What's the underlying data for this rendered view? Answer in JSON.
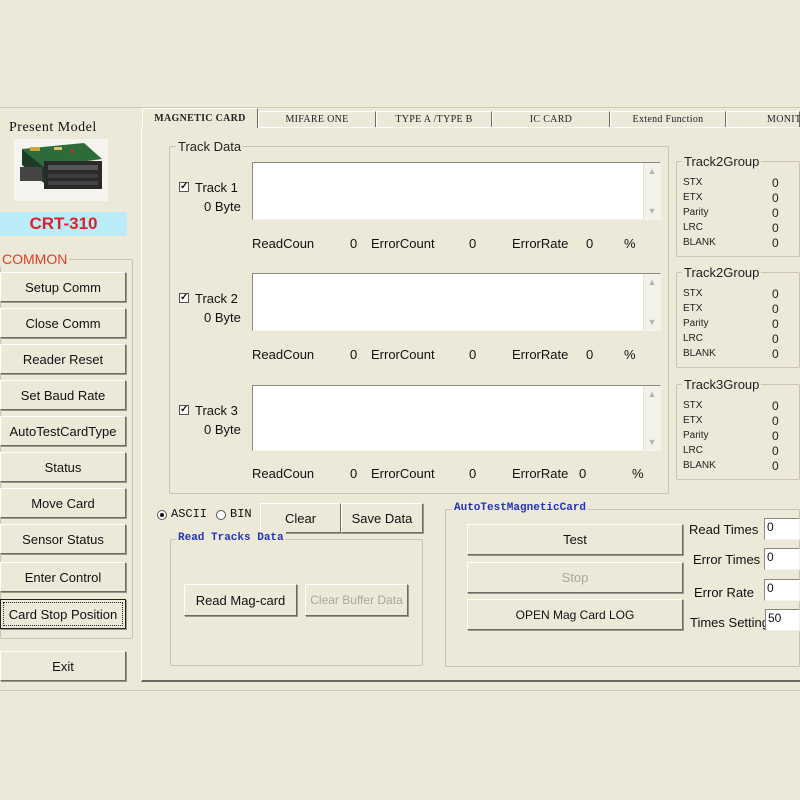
{
  "left_panel": {
    "present_model_label": "Present Model",
    "model_name": "CRT-310",
    "common_label": "COMMON",
    "buttons": [
      "Setup Comm",
      "Close Comm",
      "Reader Reset",
      "Set Baud Rate",
      "AutoTestCardType",
      "Status",
      "Move Card",
      "Sensor Status",
      "Enter Control",
      "Card Stop Position"
    ],
    "exit_label": "Exit"
  },
  "tabs": [
    "MAGNETIC CARD",
    "MIFARE ONE",
    "TYPE A /TYPE B",
    "IC CARD",
    "Extend Function",
    "MONITO"
  ],
  "track_data": {
    "title": "Track Data",
    "tracks": [
      {
        "label": "Track 1",
        "checked": true,
        "bytes": "0 Byte",
        "read_label": "ReadCoun",
        "read_count": "0",
        "error_label": "ErrorCount",
        "error_count": "0",
        "rate_label": "ErrorRate",
        "rate": "0",
        "percent": "%"
      },
      {
        "label": "Track 2",
        "checked": true,
        "bytes": "0 Byte",
        "read_label": "ReadCoun",
        "read_count": "0",
        "error_label": "ErrorCount",
        "error_count": "0",
        "rate_label": "ErrorRate",
        "rate": "0",
        "percent": "%"
      },
      {
        "label": "Track 3",
        "checked": true,
        "bytes": "0 Byte",
        "read_label": "ReadCoun",
        "read_count": "0",
        "error_label": "ErrorCount",
        "error_count": "0",
        "rate_label": "ErrorRate",
        "rate": "0",
        "percent": "%"
      }
    ]
  },
  "groups": [
    {
      "title": "Track2Group",
      "rows": [
        {
          "k": "STX",
          "v": "0"
        },
        {
          "k": "ETX",
          "v": "0"
        },
        {
          "k": "Parity",
          "v": "0"
        },
        {
          "k": "LRC",
          "v": "0"
        },
        {
          "k": "BLANK",
          "v": "0"
        }
      ]
    },
    {
      "title": "Track2Group",
      "rows": [
        {
          "k": "STX",
          "v": "0"
        },
        {
          "k": "ETX",
          "v": "0"
        },
        {
          "k": "Parity",
          "v": "0"
        },
        {
          "k": "LRC",
          "v": "0"
        },
        {
          "k": "BLANK",
          "v": "0"
        }
      ]
    },
    {
      "title": "Track3Group",
      "rows": [
        {
          "k": "STX",
          "v": "0"
        },
        {
          "k": "ETX",
          "v": "0"
        },
        {
          "k": "Parity",
          "v": "0"
        },
        {
          "k": "LRC",
          "v": "0"
        },
        {
          "k": "BLANK",
          "v": "0"
        }
      ]
    }
  ],
  "format": {
    "ascii_label": "ASCII",
    "bin_label": "BIN",
    "selected": "ASCII"
  },
  "actions": {
    "clear": "Clear",
    "save": "Save Data"
  },
  "read_tracks": {
    "title": "Read Tracks Data",
    "read_mag": "Read Mag-card",
    "clear_buffer": "Clear Buffer Data"
  },
  "auto_test": {
    "title": "AutoTestMagneticCard",
    "test": "Test",
    "stop": "Stop",
    "open_log": "OPEN Mag Card LOG",
    "read_times_label": "Read Times",
    "read_times": "0",
    "error_times_label": "Error Times",
    "error_times": "0",
    "error_rate_label": "Error Rate",
    "error_rate": "0",
    "times_setting_label": "Times Setting",
    "times_setting": "50"
  }
}
